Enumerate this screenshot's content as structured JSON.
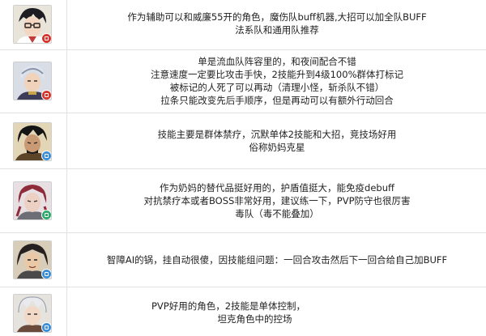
{
  "colors": {
    "badge_red": "#d6362e",
    "badge_green": "#2eaa6a",
    "badge_blue": "#3a8fd8",
    "grid": "#e2e2e2"
  },
  "rows": [
    {
      "icon": "character-portrait-icon",
      "badge": "badge_red",
      "lines": [
        "作为辅助可以和威廉55开的角色，魔伤队buff机器,大招可以加全队BUFF",
        "法系队和通用队推荐"
      ]
    },
    {
      "icon": "character-portrait-icon",
      "badge": "badge_red",
      "lines": [
        "单是流血队阵容里的，和夜间配合不错",
        "注意速度一定要比攻击手快，2技能升到4级100%群体打标记",
        "被标记的人死了可以再动（清理小怪，斩杀队不错）",
        "拉条只能改变先后手顺序，但是再动可以有额外行动回合"
      ]
    },
    {
      "icon": "character-portrait-icon",
      "badge": "badge_blue",
      "lines": [
        "技能主要是群体禁疗，沉默单体2技能和大招，竞技场好用",
        "俗称奶妈克星"
      ]
    },
    {
      "icon": "character-portrait-icon",
      "badge": "badge_green",
      "lines": [
        "作为奶妈的替代品挺好用的，护盾值挺大，能免疫debuff",
        "对抗禁疗本或者BOSS非常好用，建议练一下，PVP防守也很厉害",
        "毒队（毒不能叠加）"
      ]
    },
    {
      "icon": "character-portrait-icon",
      "badge": "badge_blue",
      "lines": [
        "智障AI的锅，挂自动很傻，因技能组问题：一回合攻击然后下一回合给自己加BUFF"
      ]
    },
    {
      "icon": "character-portrait-icon",
      "badge": "badge_blue",
      "lines": [
        "PVP好用的角色，2技能是单体控制，",
        "坦克角色中的控场"
      ]
    }
  ]
}
